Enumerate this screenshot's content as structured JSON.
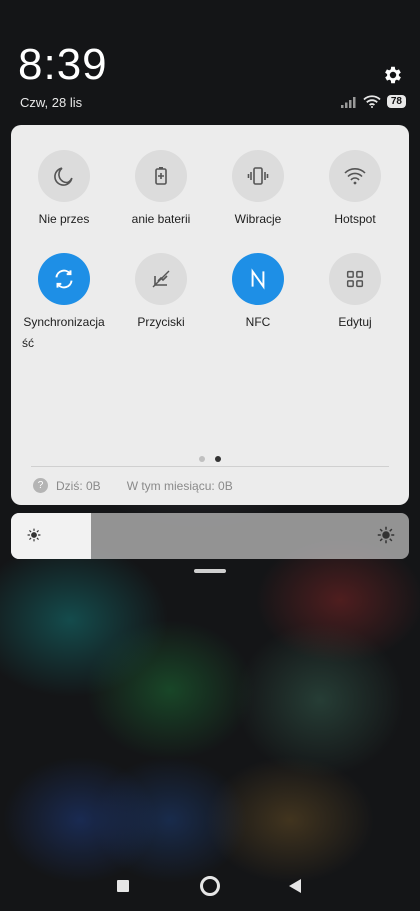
{
  "status_bar": {
    "time": "8:39",
    "date": "Czw, 28 lis",
    "battery": "78",
    "icons": [
      "signal-icon",
      "wifi-icon",
      "battery-icon"
    ]
  },
  "quick_settings": {
    "partial_label": "ść",
    "row1": [
      {
        "label": "Nie przes",
        "icon": "moon-icon",
        "active": false
      },
      {
        "label": "anie baterii",
        "icon": "battery-saver-icon",
        "active": false
      },
      {
        "label": "Wibracje",
        "icon": "vibrate-icon",
        "active": false
      },
      {
        "label": "Hotspot",
        "icon": "hotspot-icon",
        "active": false
      }
    ],
    "row2": [
      {
        "label": "Synchronizacja",
        "icon": "sync-icon",
        "active": true
      },
      {
        "label": "Przyciski",
        "icon": "buttons-icon",
        "active": false
      },
      {
        "label": "NFC",
        "icon": "nfc-icon",
        "active": true
      },
      {
        "label": "Edytuj",
        "icon": "edit-grid-icon",
        "active": false
      }
    ],
    "page_count": 2,
    "current_page": 2
  },
  "data_usage": {
    "icon": "?",
    "today": "Dziś: 0B",
    "month": "W tym miesiącu: 0B"
  },
  "brightness": {
    "level": 0.2
  },
  "colors": {
    "accent": "#1e8fe6",
    "panel": "#ececec"
  }
}
